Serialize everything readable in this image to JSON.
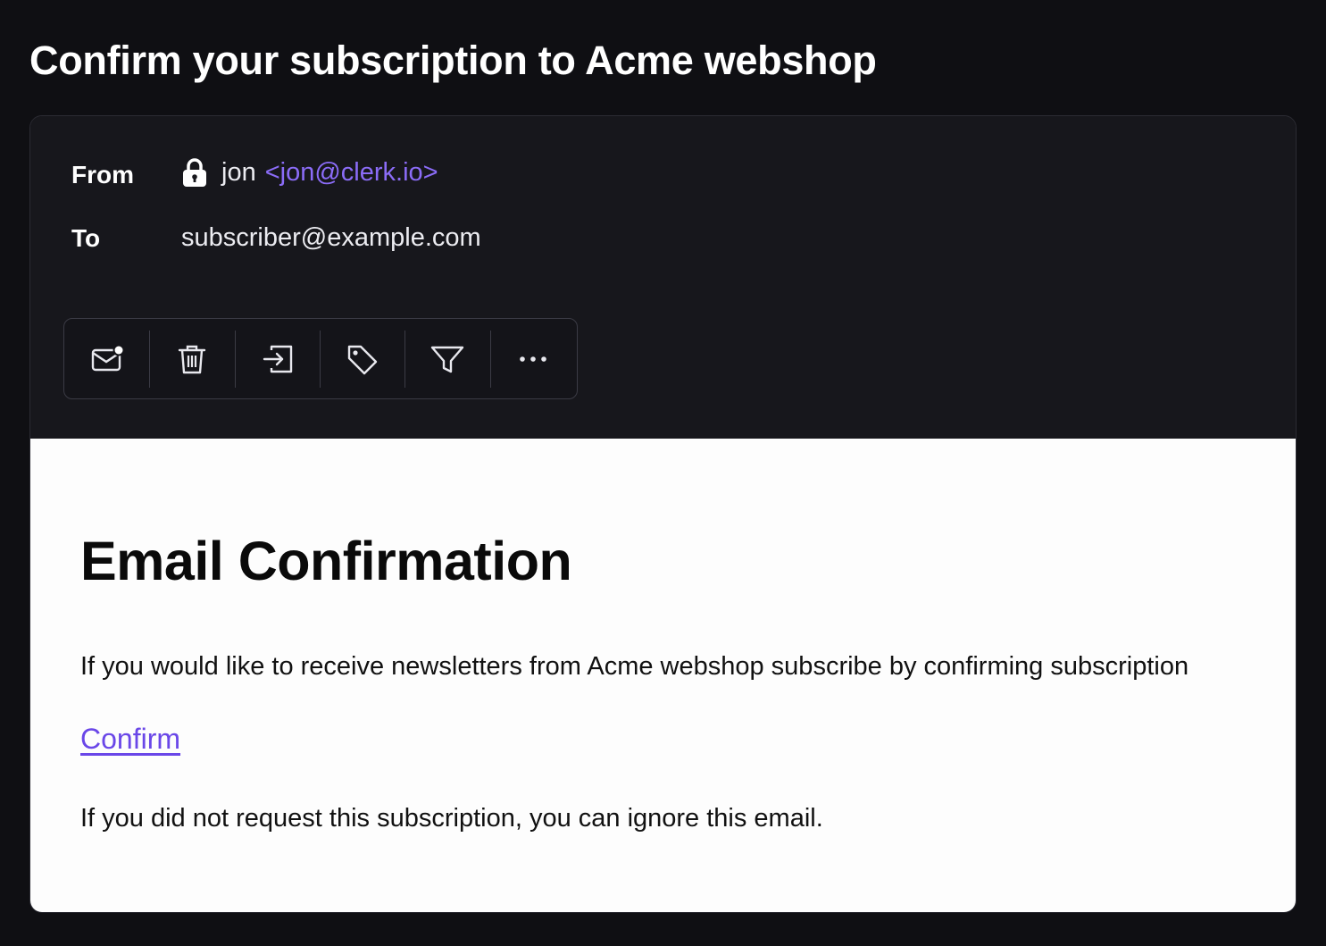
{
  "email": {
    "subject": "Confirm your subscription to Acme webshop",
    "from_label": "From",
    "sender_name": "jon",
    "sender_email": "<jon@clerk.io>",
    "to_label": "To",
    "recipient": "subscriber@example.com"
  },
  "toolbar": {
    "buttons": [
      {
        "name": "mark-unread",
        "icon": "mail-unread-icon"
      },
      {
        "name": "delete",
        "icon": "trash-icon"
      },
      {
        "name": "move",
        "icon": "move-to-icon"
      },
      {
        "name": "label",
        "icon": "tag-icon"
      },
      {
        "name": "filter",
        "icon": "filter-icon"
      },
      {
        "name": "more",
        "icon": "more-horizontal-icon"
      }
    ]
  },
  "body": {
    "heading": "Email Confirmation",
    "intro": "If you would like to receive newsletters from Acme webshop subscribe by confirming subscription",
    "confirm_label": "Confirm",
    "footer": "If you did not request this subscription, you can ignore this email."
  },
  "colors": {
    "background": "#0f0f13",
    "card": "#17171c",
    "accent": "#8b6cf7",
    "link": "#6a47e8",
    "body_bg": "#fdfdfd"
  }
}
